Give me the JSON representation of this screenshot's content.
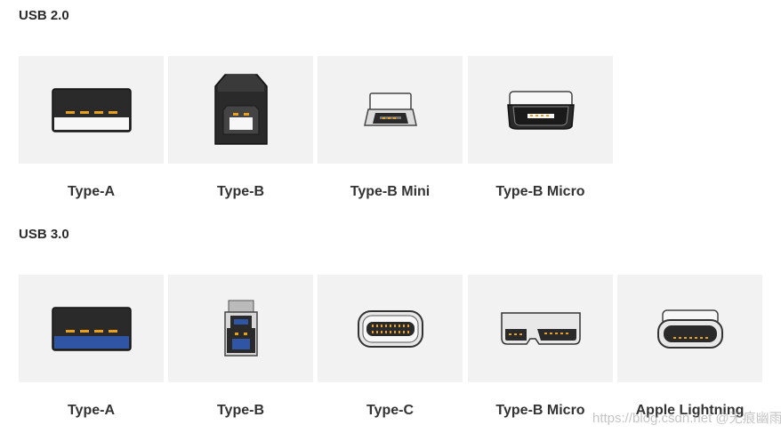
{
  "sections": [
    {
      "title": "USB 2.0",
      "items": [
        {
          "label": "Type-A",
          "icon": "usb2-type-a-connector-icon"
        },
        {
          "label": "Type-B",
          "icon": "usb2-type-b-connector-icon"
        },
        {
          "label": "Type-B Mini",
          "icon": "usb2-type-b-mini-connector-icon"
        },
        {
          "label": "Type-B Micro",
          "icon": "usb2-type-b-micro-connector-icon"
        }
      ]
    },
    {
      "title": "USB 3.0",
      "items": [
        {
          "label": "Type-A",
          "icon": "usb3-type-a-connector-icon"
        },
        {
          "label": "Type-B",
          "icon": "usb3-type-b-connector-icon"
        },
        {
          "label": "Type-C",
          "icon": "usb-type-c-connector-icon"
        },
        {
          "label": "Type-B Micro",
          "icon": "usb3-type-b-micro-connector-icon"
        },
        {
          "label": "Apple Lightning",
          "icon": "apple-lightning-connector-icon"
        }
      ]
    }
  ],
  "watermark": "https://blog.csdn.net @无痕幽雨",
  "colors": {
    "card_bg": "#f2f2f2",
    "connector_dark": "#2a2a2a",
    "usb3_blue": "#2f55a4",
    "pin_gold": "#e8a020"
  }
}
